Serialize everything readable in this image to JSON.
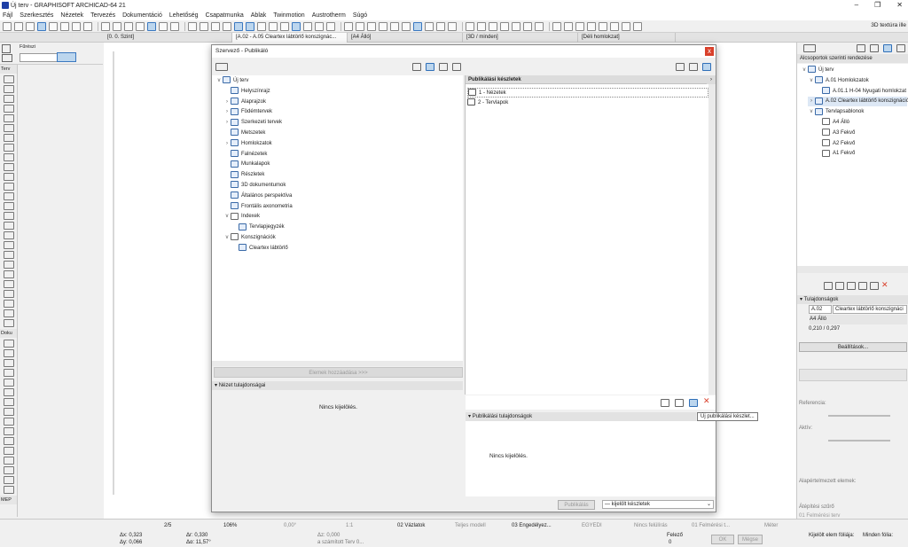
{
  "window": {
    "title": "Új terv - GRAPHISOFT ARCHICAD-64 21",
    "min": "–",
    "max": "❐",
    "close": "✕"
  },
  "menu": [
    "Fájl",
    "Szerkesztés",
    "Nézetek",
    "Tervezés",
    "Dokumentáció",
    "Lehetőség",
    "Csapatmunka",
    "Ablak",
    "Twinmotion",
    "Austrotherm",
    "Súgó"
  ],
  "toolbar": {
    "texture": "3D textúra ille"
  },
  "tabs": [
    {
      "label": "[0. 0. Szint]",
      "active": false
    },
    {
      "label": "[A.02 - A.05 Cleartex lábtörlő konszignác...",
      "active": true
    },
    {
      "label": "[A4 Álló]",
      "active": false
    },
    {
      "label": "[3D / minden]",
      "active": false
    },
    {
      "label": "[Déli homlokzat]",
      "active": false
    }
  ],
  "infobox": {
    "label": "Fűrészi"
  },
  "toolbox": {
    "terv": "Terv",
    "doku": "Doku",
    "mep": "MEP"
  },
  "dialog": {
    "title": "Szervező - Publikáló",
    "close": "x",
    "tree": [
      {
        "label": "Új terv",
        "level": 0,
        "arrow": "v"
      },
      {
        "label": "Helyszínrajz",
        "level": 1,
        "arrow": ""
      },
      {
        "label": "Alaprajzok",
        "level": 1,
        "arrow": ">"
      },
      {
        "label": "Födémtervek",
        "level": 1,
        "arrow": ">"
      },
      {
        "label": "Szerkezeti tervek",
        "level": 1,
        "arrow": ">"
      },
      {
        "label": "Metszetek",
        "level": 1,
        "arrow": ""
      },
      {
        "label": "Homlokzatok",
        "level": 1,
        "arrow": ">"
      },
      {
        "label": "Falnézetek",
        "level": 1,
        "arrow": ""
      },
      {
        "label": "Munkalapok",
        "level": 1,
        "arrow": ""
      },
      {
        "label": "Részletek",
        "level": 1,
        "arrow": ""
      },
      {
        "label": "3D dokumentumok",
        "level": 1,
        "arrow": ""
      },
      {
        "label": "Általános perspektíva",
        "level": 1,
        "arrow": ""
      },
      {
        "label": "Frontális axonometria",
        "level": 1,
        "arrow": ""
      },
      {
        "label": "Indexek",
        "level": 1,
        "arrow": "v"
      },
      {
        "label": "Tervlapjegyzék",
        "level": 2,
        "arrow": ""
      },
      {
        "label": "Konszignációk",
        "level": 1,
        "arrow": "v"
      },
      {
        "label": "Cleartex lábtörlő",
        "level": 2,
        "arrow": ""
      }
    ],
    "add_button": "Elemek hozzáadása >>>",
    "view_props": "Nézet tulajdonságai",
    "no_selection": "Nincs kijelölés.",
    "publish_sets_header": "Publikálási készletek",
    "publish_sets": [
      "1 - Nézetek",
      "2 - Tervlapok"
    ],
    "tooltip": "Új publikálási készlet...",
    "publish_props": "Publikálási tulajdonságok",
    "no_selection_right": "Nincs kijelölés.",
    "publish_button": "Publikálás",
    "publish_select": "kijelölt készletek"
  },
  "right_panel": {
    "header": "Alcsoportok szerinti rendezése",
    "tree": [
      {
        "label": "Új terv",
        "level": 0
      },
      {
        "label": "A.01 Homlokzatok",
        "level": 1
      },
      {
        "label": "A.01.1 H-04 Nyugati homlokzat",
        "level": 2
      },
      {
        "label": "A.02 Cleartex lábtörlő konszignáció",
        "level": 1
      },
      {
        "label": "Tervlapsablonok",
        "level": 1
      },
      {
        "label": "A4 Álló",
        "level": 2
      },
      {
        "label": "A3 Fekvő",
        "level": 2
      },
      {
        "label": "A2 Fekvő",
        "level": 2
      },
      {
        "label": "A1 Fekvő",
        "level": 2
      }
    ],
    "props_header": "Tulajdonságok",
    "prop_id": "A.02",
    "prop_name": "Cleartex lábtörlő konszignáci",
    "prop_layout": "A4 Álló",
    "prop_size": "0,210 / 0,297",
    "settings_button": "Beállítások...",
    "reference": "Referencia:",
    "active": "Aktív:",
    "default_elements": "Alapértelmezett elemek:",
    "filter_label": "Átépítési szűrő",
    "filter_value": "01 Felmérési terv"
  },
  "statusbar": {
    "page": "2/5",
    "zoom": "106%",
    "angle": "0,00°",
    "scale": "1:1",
    "view_count": "02 Vázlatok",
    "model": "Teljes modell",
    "permit": "03 Engedélyez...",
    "custom": "EGYEDI",
    "no_override": "Nincs felülírás",
    "survey": "01 Felmérési t...",
    "unit": "Méter",
    "dx": "Δx: 0,323",
    "dy": "Δy: 0,066",
    "dr": "Δr: 0,330",
    "da": "Δα: 11,57°",
    "dz": "Δz: 0,000",
    "dz2": "a számított Terv 0...",
    "floor": "Felező",
    "floor2": "0",
    "ok": "OK",
    "cancel": "Mégse",
    "selected": "Kijelölt elem fóliája:",
    "all": "Minden fólia:"
  }
}
